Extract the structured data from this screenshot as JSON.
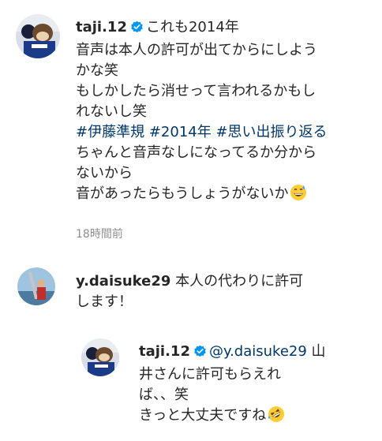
{
  "comments": [
    {
      "username": "taji.12",
      "verified": true,
      "lines": [
        "これも2014年",
        "音声は本人の許可が出てからにしよう",
        "かな笑",
        "もしかしたら消せって言われるかもし",
        "れないし笑"
      ],
      "hashtags": [
        "#伊藤準規",
        "#2014年",
        "#思い出振り返る"
      ],
      "lines2": [
        "ちゃんと音声なしになってるか分から",
        "ないから",
        "音があったらもうしょうがないか"
      ],
      "end_emoji": "sweat-smile-emoji",
      "time": "18時間前"
    },
    {
      "username": "y.daisuke29",
      "verified": false,
      "lines": [
        "本人の代わりに許可",
        "します！"
      ]
    },
    {
      "username": "taji.12",
      "verified": true,
      "mention": "@y.daisuke29",
      "lines": [
        "山",
        "井さんに許可もらえれ",
        "ば、、笑",
        "きっと大丈夫ですね"
      ],
      "end_emoji": "rolling-laughing-emoji"
    }
  ],
  "colors": {
    "text": "#262626",
    "hashtag": "#00376b",
    "time": "#8e8e8e",
    "verified": "#0095f6"
  }
}
